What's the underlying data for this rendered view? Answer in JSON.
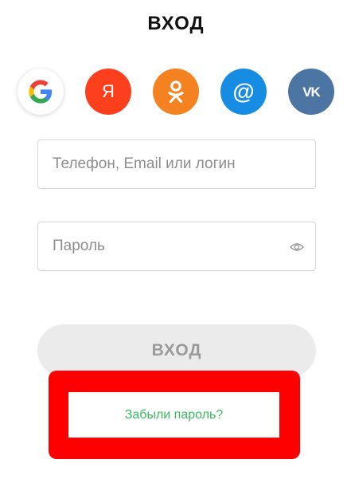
{
  "header": {
    "title": "ВХОД"
  },
  "social": {
    "items": [
      {
        "name": "google",
        "icon": "google-icon",
        "glyph": "G",
        "color": "#ffffff"
      },
      {
        "name": "yandex",
        "icon": "yandex-icon",
        "glyph": "Я",
        "color": "#fc3f1d"
      },
      {
        "name": "odnoklassniki",
        "icon": "odnoklassniki-icon",
        "glyph": "ok",
        "color": "#f58220"
      },
      {
        "name": "mailru",
        "icon": "at-icon",
        "glyph": "@",
        "color": "#168de2"
      },
      {
        "name": "vk",
        "icon": "vk-icon",
        "glyph": "VK",
        "color": "#4c75a3"
      }
    ]
  },
  "form": {
    "login_placeholder": "Телефон, Email или логин",
    "login_value": "",
    "password_placeholder": "Пароль",
    "password_value": "",
    "submit_label": "ВХОД",
    "forgot_label": "Забыли пароль?"
  },
  "colors": {
    "accent_green": "#3bb85e",
    "highlight_red": "#ff0000",
    "button_disabled": "#ebebeb"
  }
}
